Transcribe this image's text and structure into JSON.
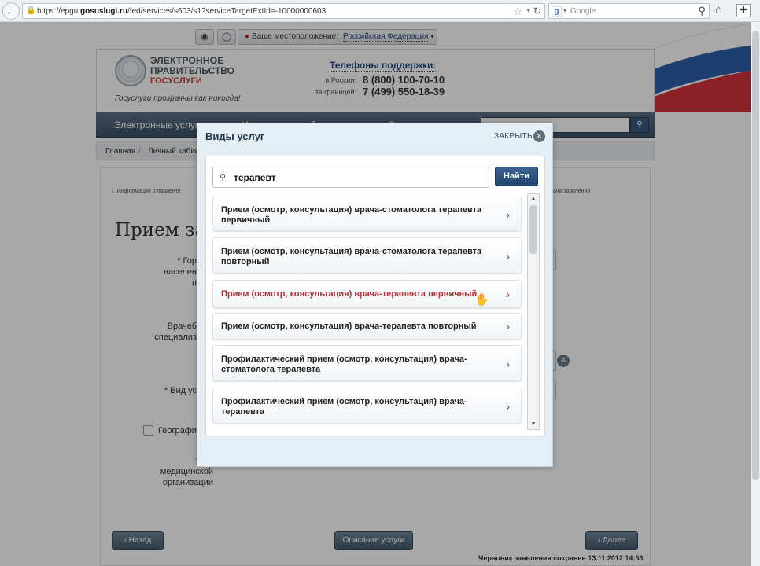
{
  "browser": {
    "url_prefix": "https://epgu.",
    "url_host": "gosuslugi.ru",
    "url_path": "/fed/services/s603/s1?serviceTargetExtId=-10000000603",
    "search_placeholder": "Google",
    "search_engine_letter": "g"
  },
  "site": {
    "location_label": "Ваше местоположение:",
    "location_value": "Российская Федерация",
    "logo_line1": "ЭЛЕКТРОННОЕ",
    "logo_line2": "ПРАВИТЕЛЬСТВО",
    "logo_line3": "ГОСУСЛУГИ",
    "slogan": "Госуслуги прозрачны как никогда!",
    "phones_title": "Телефоны поддержки:",
    "phones": [
      {
        "label": "в России:",
        "number": "8 (800) 100-70-10"
      },
      {
        "label": "за границей:",
        "number": "7 (499) 550-18-39"
      }
    ],
    "nav": [
      "Электронные услуги",
      "Ин",
      "б",
      "О"
    ],
    "breadcrumbs": [
      "Главная",
      "Личный кабинет"
    ]
  },
  "form": {
    "step1": "1. Информация о пациенте",
    "step_last": "ача заявления",
    "title": "Прием за",
    "labels": {
      "city": "* Гор\nнаселен\nп",
      "doctor": "Врачеб\nспециализ",
      "service": "* Вид ус",
      "geo": "Географи",
      "org": "* Вы\nмедицинской\nорганизации"
    }
  },
  "buttons": {
    "back": "Назад",
    "description": "Описание услуги",
    "next": "Далее"
  },
  "saved_text": "Черновик заявления сохранен 13.11.2012 14:53",
  "modal": {
    "title": "Виды услуг",
    "close_label": "ЗАКРЫТЬ",
    "search_value": "терапевт",
    "find_label": "Найти",
    "items": [
      {
        "label": "Прием (осмотр, консультация) врача-стоматолога терапевта первичный"
      },
      {
        "label": "Прием (осмотр, консультация) врача-стоматолога терапевта повторный"
      },
      {
        "label": "Прием (осмотр, консультация) врача-терапевта первичный"
      },
      {
        "label": "Прием (осмотр, консультация) врача-терапевта повторный"
      },
      {
        "label": "Профилактический прием (осмотр, консультация) врача-стоматолога терапевта"
      },
      {
        "label": "Профилактический прием (осмотр, консультация) врача-терапевта"
      }
    ],
    "highlighted_index": 2
  },
  "colors": {
    "accent_red": "#c23b3b",
    "nav_blue": "#45596d",
    "find_blue": "#2a4f7a",
    "highlight_text": "#b0323a"
  }
}
